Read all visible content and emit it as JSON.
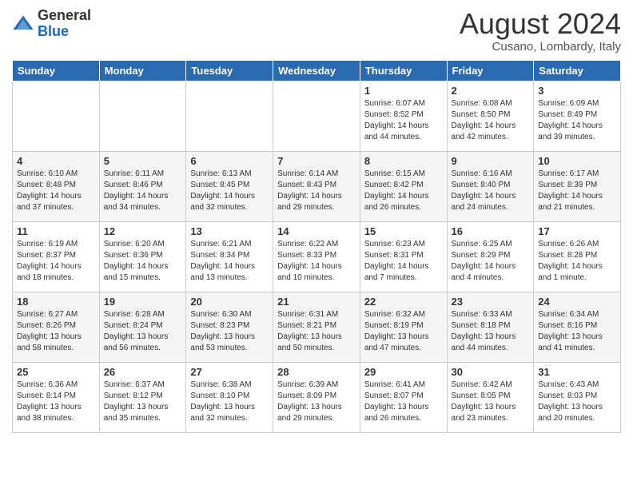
{
  "header": {
    "logo": {
      "general": "General",
      "blue": "Blue"
    },
    "month": "August 2024",
    "location": "Cusano, Lombardy, Italy"
  },
  "weekdays": [
    "Sunday",
    "Monday",
    "Tuesday",
    "Wednesday",
    "Thursday",
    "Friday",
    "Saturday"
  ],
  "weeks": [
    [
      {
        "day": "",
        "info": ""
      },
      {
        "day": "",
        "info": ""
      },
      {
        "day": "",
        "info": ""
      },
      {
        "day": "",
        "info": ""
      },
      {
        "day": "1",
        "info": "Sunrise: 6:07 AM\nSunset: 8:52 PM\nDaylight: 14 hours\nand 44 minutes."
      },
      {
        "day": "2",
        "info": "Sunrise: 6:08 AM\nSunset: 8:50 PM\nDaylight: 14 hours\nand 42 minutes."
      },
      {
        "day": "3",
        "info": "Sunrise: 6:09 AM\nSunset: 8:49 PM\nDaylight: 14 hours\nand 39 minutes."
      }
    ],
    [
      {
        "day": "4",
        "info": "Sunrise: 6:10 AM\nSunset: 8:48 PM\nDaylight: 14 hours\nand 37 minutes."
      },
      {
        "day": "5",
        "info": "Sunrise: 6:11 AM\nSunset: 8:46 PM\nDaylight: 14 hours\nand 34 minutes."
      },
      {
        "day": "6",
        "info": "Sunrise: 6:13 AM\nSunset: 8:45 PM\nDaylight: 14 hours\nand 32 minutes."
      },
      {
        "day": "7",
        "info": "Sunrise: 6:14 AM\nSunset: 8:43 PM\nDaylight: 14 hours\nand 29 minutes."
      },
      {
        "day": "8",
        "info": "Sunrise: 6:15 AM\nSunset: 8:42 PM\nDaylight: 14 hours\nand 26 minutes."
      },
      {
        "day": "9",
        "info": "Sunrise: 6:16 AM\nSunset: 8:40 PM\nDaylight: 14 hours\nand 24 minutes."
      },
      {
        "day": "10",
        "info": "Sunrise: 6:17 AM\nSunset: 8:39 PM\nDaylight: 14 hours\nand 21 minutes."
      }
    ],
    [
      {
        "day": "11",
        "info": "Sunrise: 6:19 AM\nSunset: 8:37 PM\nDaylight: 14 hours\nand 18 minutes."
      },
      {
        "day": "12",
        "info": "Sunrise: 6:20 AM\nSunset: 8:36 PM\nDaylight: 14 hours\nand 15 minutes."
      },
      {
        "day": "13",
        "info": "Sunrise: 6:21 AM\nSunset: 8:34 PM\nDaylight: 14 hours\nand 13 minutes."
      },
      {
        "day": "14",
        "info": "Sunrise: 6:22 AM\nSunset: 8:33 PM\nDaylight: 14 hours\nand 10 minutes."
      },
      {
        "day": "15",
        "info": "Sunrise: 6:23 AM\nSunset: 8:31 PM\nDaylight: 14 hours\nand 7 minutes."
      },
      {
        "day": "16",
        "info": "Sunrise: 6:25 AM\nSunset: 8:29 PM\nDaylight: 14 hours\nand 4 minutes."
      },
      {
        "day": "17",
        "info": "Sunrise: 6:26 AM\nSunset: 8:28 PM\nDaylight: 14 hours\nand 1 minute."
      }
    ],
    [
      {
        "day": "18",
        "info": "Sunrise: 6:27 AM\nSunset: 8:26 PM\nDaylight: 13 hours\nand 58 minutes."
      },
      {
        "day": "19",
        "info": "Sunrise: 6:28 AM\nSunset: 8:24 PM\nDaylight: 13 hours\nand 56 minutes."
      },
      {
        "day": "20",
        "info": "Sunrise: 6:30 AM\nSunset: 8:23 PM\nDaylight: 13 hours\nand 53 minutes."
      },
      {
        "day": "21",
        "info": "Sunrise: 6:31 AM\nSunset: 8:21 PM\nDaylight: 13 hours\nand 50 minutes."
      },
      {
        "day": "22",
        "info": "Sunrise: 6:32 AM\nSunset: 8:19 PM\nDaylight: 13 hours\nand 47 minutes."
      },
      {
        "day": "23",
        "info": "Sunrise: 6:33 AM\nSunset: 8:18 PM\nDaylight: 13 hours\nand 44 minutes."
      },
      {
        "day": "24",
        "info": "Sunrise: 6:34 AM\nSunset: 8:16 PM\nDaylight: 13 hours\nand 41 minutes."
      }
    ],
    [
      {
        "day": "25",
        "info": "Sunrise: 6:36 AM\nSunset: 8:14 PM\nDaylight: 13 hours\nand 38 minutes."
      },
      {
        "day": "26",
        "info": "Sunrise: 6:37 AM\nSunset: 8:12 PM\nDaylight: 13 hours\nand 35 minutes."
      },
      {
        "day": "27",
        "info": "Sunrise: 6:38 AM\nSunset: 8:10 PM\nDaylight: 13 hours\nand 32 minutes."
      },
      {
        "day": "28",
        "info": "Sunrise: 6:39 AM\nSunset: 8:09 PM\nDaylight: 13 hours\nand 29 minutes."
      },
      {
        "day": "29",
        "info": "Sunrise: 6:41 AM\nSunset: 8:07 PM\nDaylight: 13 hours\nand 26 minutes."
      },
      {
        "day": "30",
        "info": "Sunrise: 6:42 AM\nSunset: 8:05 PM\nDaylight: 13 hours\nand 23 minutes."
      },
      {
        "day": "31",
        "info": "Sunrise: 6:43 AM\nSunset: 8:03 PM\nDaylight: 13 hours\nand 20 minutes."
      }
    ]
  ]
}
